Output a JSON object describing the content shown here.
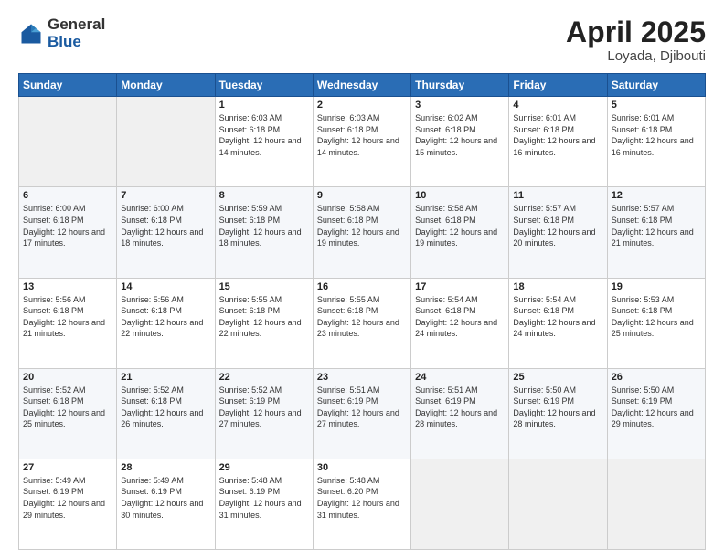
{
  "logo": {
    "general": "General",
    "blue": "Blue"
  },
  "header": {
    "month": "April 2025",
    "location": "Loyada, Djibouti"
  },
  "weekdays": [
    "Sunday",
    "Monday",
    "Tuesday",
    "Wednesday",
    "Thursday",
    "Friday",
    "Saturday"
  ],
  "weeks": [
    [
      {
        "day": "",
        "sunrise": "",
        "sunset": "",
        "daylight": ""
      },
      {
        "day": "",
        "sunrise": "",
        "sunset": "",
        "daylight": ""
      },
      {
        "day": "1",
        "sunrise": "Sunrise: 6:03 AM",
        "sunset": "Sunset: 6:18 PM",
        "daylight": "Daylight: 12 hours and 14 minutes."
      },
      {
        "day": "2",
        "sunrise": "Sunrise: 6:03 AM",
        "sunset": "Sunset: 6:18 PM",
        "daylight": "Daylight: 12 hours and 14 minutes."
      },
      {
        "day": "3",
        "sunrise": "Sunrise: 6:02 AM",
        "sunset": "Sunset: 6:18 PM",
        "daylight": "Daylight: 12 hours and 15 minutes."
      },
      {
        "day": "4",
        "sunrise": "Sunrise: 6:01 AM",
        "sunset": "Sunset: 6:18 PM",
        "daylight": "Daylight: 12 hours and 16 minutes."
      },
      {
        "day": "5",
        "sunrise": "Sunrise: 6:01 AM",
        "sunset": "Sunset: 6:18 PM",
        "daylight": "Daylight: 12 hours and 16 minutes."
      }
    ],
    [
      {
        "day": "6",
        "sunrise": "Sunrise: 6:00 AM",
        "sunset": "Sunset: 6:18 PM",
        "daylight": "Daylight: 12 hours and 17 minutes."
      },
      {
        "day": "7",
        "sunrise": "Sunrise: 6:00 AM",
        "sunset": "Sunset: 6:18 PM",
        "daylight": "Daylight: 12 hours and 18 minutes."
      },
      {
        "day": "8",
        "sunrise": "Sunrise: 5:59 AM",
        "sunset": "Sunset: 6:18 PM",
        "daylight": "Daylight: 12 hours and 18 minutes."
      },
      {
        "day": "9",
        "sunrise": "Sunrise: 5:58 AM",
        "sunset": "Sunset: 6:18 PM",
        "daylight": "Daylight: 12 hours and 19 minutes."
      },
      {
        "day": "10",
        "sunrise": "Sunrise: 5:58 AM",
        "sunset": "Sunset: 6:18 PM",
        "daylight": "Daylight: 12 hours and 19 minutes."
      },
      {
        "day": "11",
        "sunrise": "Sunrise: 5:57 AM",
        "sunset": "Sunset: 6:18 PM",
        "daylight": "Daylight: 12 hours and 20 minutes."
      },
      {
        "day": "12",
        "sunrise": "Sunrise: 5:57 AM",
        "sunset": "Sunset: 6:18 PM",
        "daylight": "Daylight: 12 hours and 21 minutes."
      }
    ],
    [
      {
        "day": "13",
        "sunrise": "Sunrise: 5:56 AM",
        "sunset": "Sunset: 6:18 PM",
        "daylight": "Daylight: 12 hours and 21 minutes."
      },
      {
        "day": "14",
        "sunrise": "Sunrise: 5:56 AM",
        "sunset": "Sunset: 6:18 PM",
        "daylight": "Daylight: 12 hours and 22 minutes."
      },
      {
        "day": "15",
        "sunrise": "Sunrise: 5:55 AM",
        "sunset": "Sunset: 6:18 PM",
        "daylight": "Daylight: 12 hours and 22 minutes."
      },
      {
        "day": "16",
        "sunrise": "Sunrise: 5:55 AM",
        "sunset": "Sunset: 6:18 PM",
        "daylight": "Daylight: 12 hours and 23 minutes."
      },
      {
        "day": "17",
        "sunrise": "Sunrise: 5:54 AM",
        "sunset": "Sunset: 6:18 PM",
        "daylight": "Daylight: 12 hours and 24 minutes."
      },
      {
        "day": "18",
        "sunrise": "Sunrise: 5:54 AM",
        "sunset": "Sunset: 6:18 PM",
        "daylight": "Daylight: 12 hours and 24 minutes."
      },
      {
        "day": "19",
        "sunrise": "Sunrise: 5:53 AM",
        "sunset": "Sunset: 6:18 PM",
        "daylight": "Daylight: 12 hours and 25 minutes."
      }
    ],
    [
      {
        "day": "20",
        "sunrise": "Sunrise: 5:52 AM",
        "sunset": "Sunset: 6:18 PM",
        "daylight": "Daylight: 12 hours and 25 minutes."
      },
      {
        "day": "21",
        "sunrise": "Sunrise: 5:52 AM",
        "sunset": "Sunset: 6:18 PM",
        "daylight": "Daylight: 12 hours and 26 minutes."
      },
      {
        "day": "22",
        "sunrise": "Sunrise: 5:52 AM",
        "sunset": "Sunset: 6:19 PM",
        "daylight": "Daylight: 12 hours and 27 minutes."
      },
      {
        "day": "23",
        "sunrise": "Sunrise: 5:51 AM",
        "sunset": "Sunset: 6:19 PM",
        "daylight": "Daylight: 12 hours and 27 minutes."
      },
      {
        "day": "24",
        "sunrise": "Sunrise: 5:51 AM",
        "sunset": "Sunset: 6:19 PM",
        "daylight": "Daylight: 12 hours and 28 minutes."
      },
      {
        "day": "25",
        "sunrise": "Sunrise: 5:50 AM",
        "sunset": "Sunset: 6:19 PM",
        "daylight": "Daylight: 12 hours and 28 minutes."
      },
      {
        "day": "26",
        "sunrise": "Sunrise: 5:50 AM",
        "sunset": "Sunset: 6:19 PM",
        "daylight": "Daylight: 12 hours and 29 minutes."
      }
    ],
    [
      {
        "day": "27",
        "sunrise": "Sunrise: 5:49 AM",
        "sunset": "Sunset: 6:19 PM",
        "daylight": "Daylight: 12 hours and 29 minutes."
      },
      {
        "day": "28",
        "sunrise": "Sunrise: 5:49 AM",
        "sunset": "Sunset: 6:19 PM",
        "daylight": "Daylight: 12 hours and 30 minutes."
      },
      {
        "day": "29",
        "sunrise": "Sunrise: 5:48 AM",
        "sunset": "Sunset: 6:19 PM",
        "daylight": "Daylight: 12 hours and 31 minutes."
      },
      {
        "day": "30",
        "sunrise": "Sunrise: 5:48 AM",
        "sunset": "Sunset: 6:20 PM",
        "daylight": "Daylight: 12 hours and 31 minutes."
      },
      {
        "day": "",
        "sunrise": "",
        "sunset": "",
        "daylight": ""
      },
      {
        "day": "",
        "sunrise": "",
        "sunset": "",
        "daylight": ""
      },
      {
        "day": "",
        "sunrise": "",
        "sunset": "",
        "daylight": ""
      }
    ]
  ]
}
